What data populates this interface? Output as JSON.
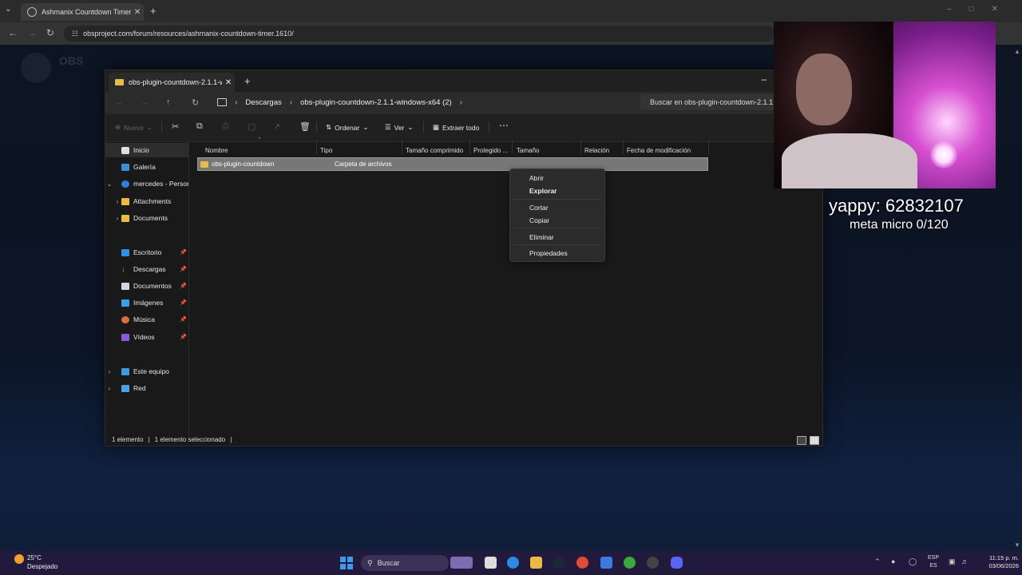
{
  "browser": {
    "tab_title": "Ashmanix Countdown Timer | O",
    "url": "obsproject.com/forum/resources/ashmanix-countdown-timer.1610/",
    "web_logo_text": "OBS"
  },
  "explorer": {
    "tab_title": "obs-plugin-countdown-2.1.1-w",
    "breadcrumb": [
      "Descargas",
      "obs-plugin-countdown-2.1.1-windows-x64 (2)"
    ],
    "search_placeholder": "Buscar en obs-plugin-countdown-2.1.1",
    "toolbar": {
      "new_label": "Nuevo",
      "sort_label": "Ordenar",
      "view_label": "Ver",
      "extract_label": "Extraer todo",
      "more_label": "⋯"
    },
    "sidebar": {
      "home": "Inicio",
      "gallery": "Galería",
      "onedrive": "mercedes - Personal",
      "attachments": "Attachments",
      "documents_cloud": "Documents",
      "desktop": "Escritorio",
      "downloads": "Descargas",
      "documents": "Documentos",
      "images": "Imágenes",
      "music": "Música",
      "videos": "Vídeos",
      "this_pc": "Este equipo",
      "network": "Red"
    },
    "columns": [
      "Nombre",
      "Tipo",
      "Tamaño comprimido",
      "Protegido ...",
      "Tamaño",
      "Relación",
      "Fecha de modificación"
    ],
    "file": {
      "name": "obs-plugin-countdown",
      "type": "Carpeta de archivos"
    },
    "context_menu": [
      "Abrir",
      "Explorar",
      "Cortar",
      "Copiar",
      "Eliminar",
      "Propiedades"
    ],
    "status": {
      "count": "1 elemento",
      "selected": "1 elemento seleccionado"
    }
  },
  "overlay": {
    "yappy": "yappy: 62832107",
    "meta": "meta micro 0/120"
  },
  "taskbar": {
    "weather_temp": "25°C",
    "weather_desc": "Despejado",
    "search_label": "Buscar",
    "lang_top": "ESP",
    "lang_bottom": "ES",
    "time": "11:15 p. m.",
    "date": "03/06/2026"
  },
  "colors": {
    "taskbar": "#221a3c",
    "explorer_bg": "#191919",
    "folder": "#e9b949",
    "selection": "#777777"
  }
}
